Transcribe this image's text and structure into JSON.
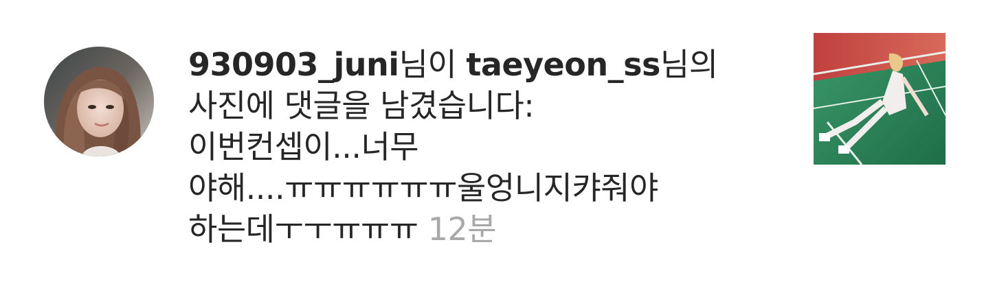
{
  "notification": {
    "actor_username": "930903_juni",
    "actor_suffix": "님이 ",
    "target_username": "taeyeon_ss",
    "target_suffix": "님의",
    "action_text": "사진에 댓글을 남겼습니다:",
    "comment_line1": "이번컨셉이...너무",
    "comment_line2": "야해....ㅠㅠㅠㅠㅠㅠ울엉니지캬줘야",
    "comment_line3": "하는데ㅜㅜㅠㅠㅠ",
    "timestamp": "12분"
  },
  "colors": {
    "text": "#262626",
    "time": "#a8a8a8",
    "background": "#ffffff"
  }
}
